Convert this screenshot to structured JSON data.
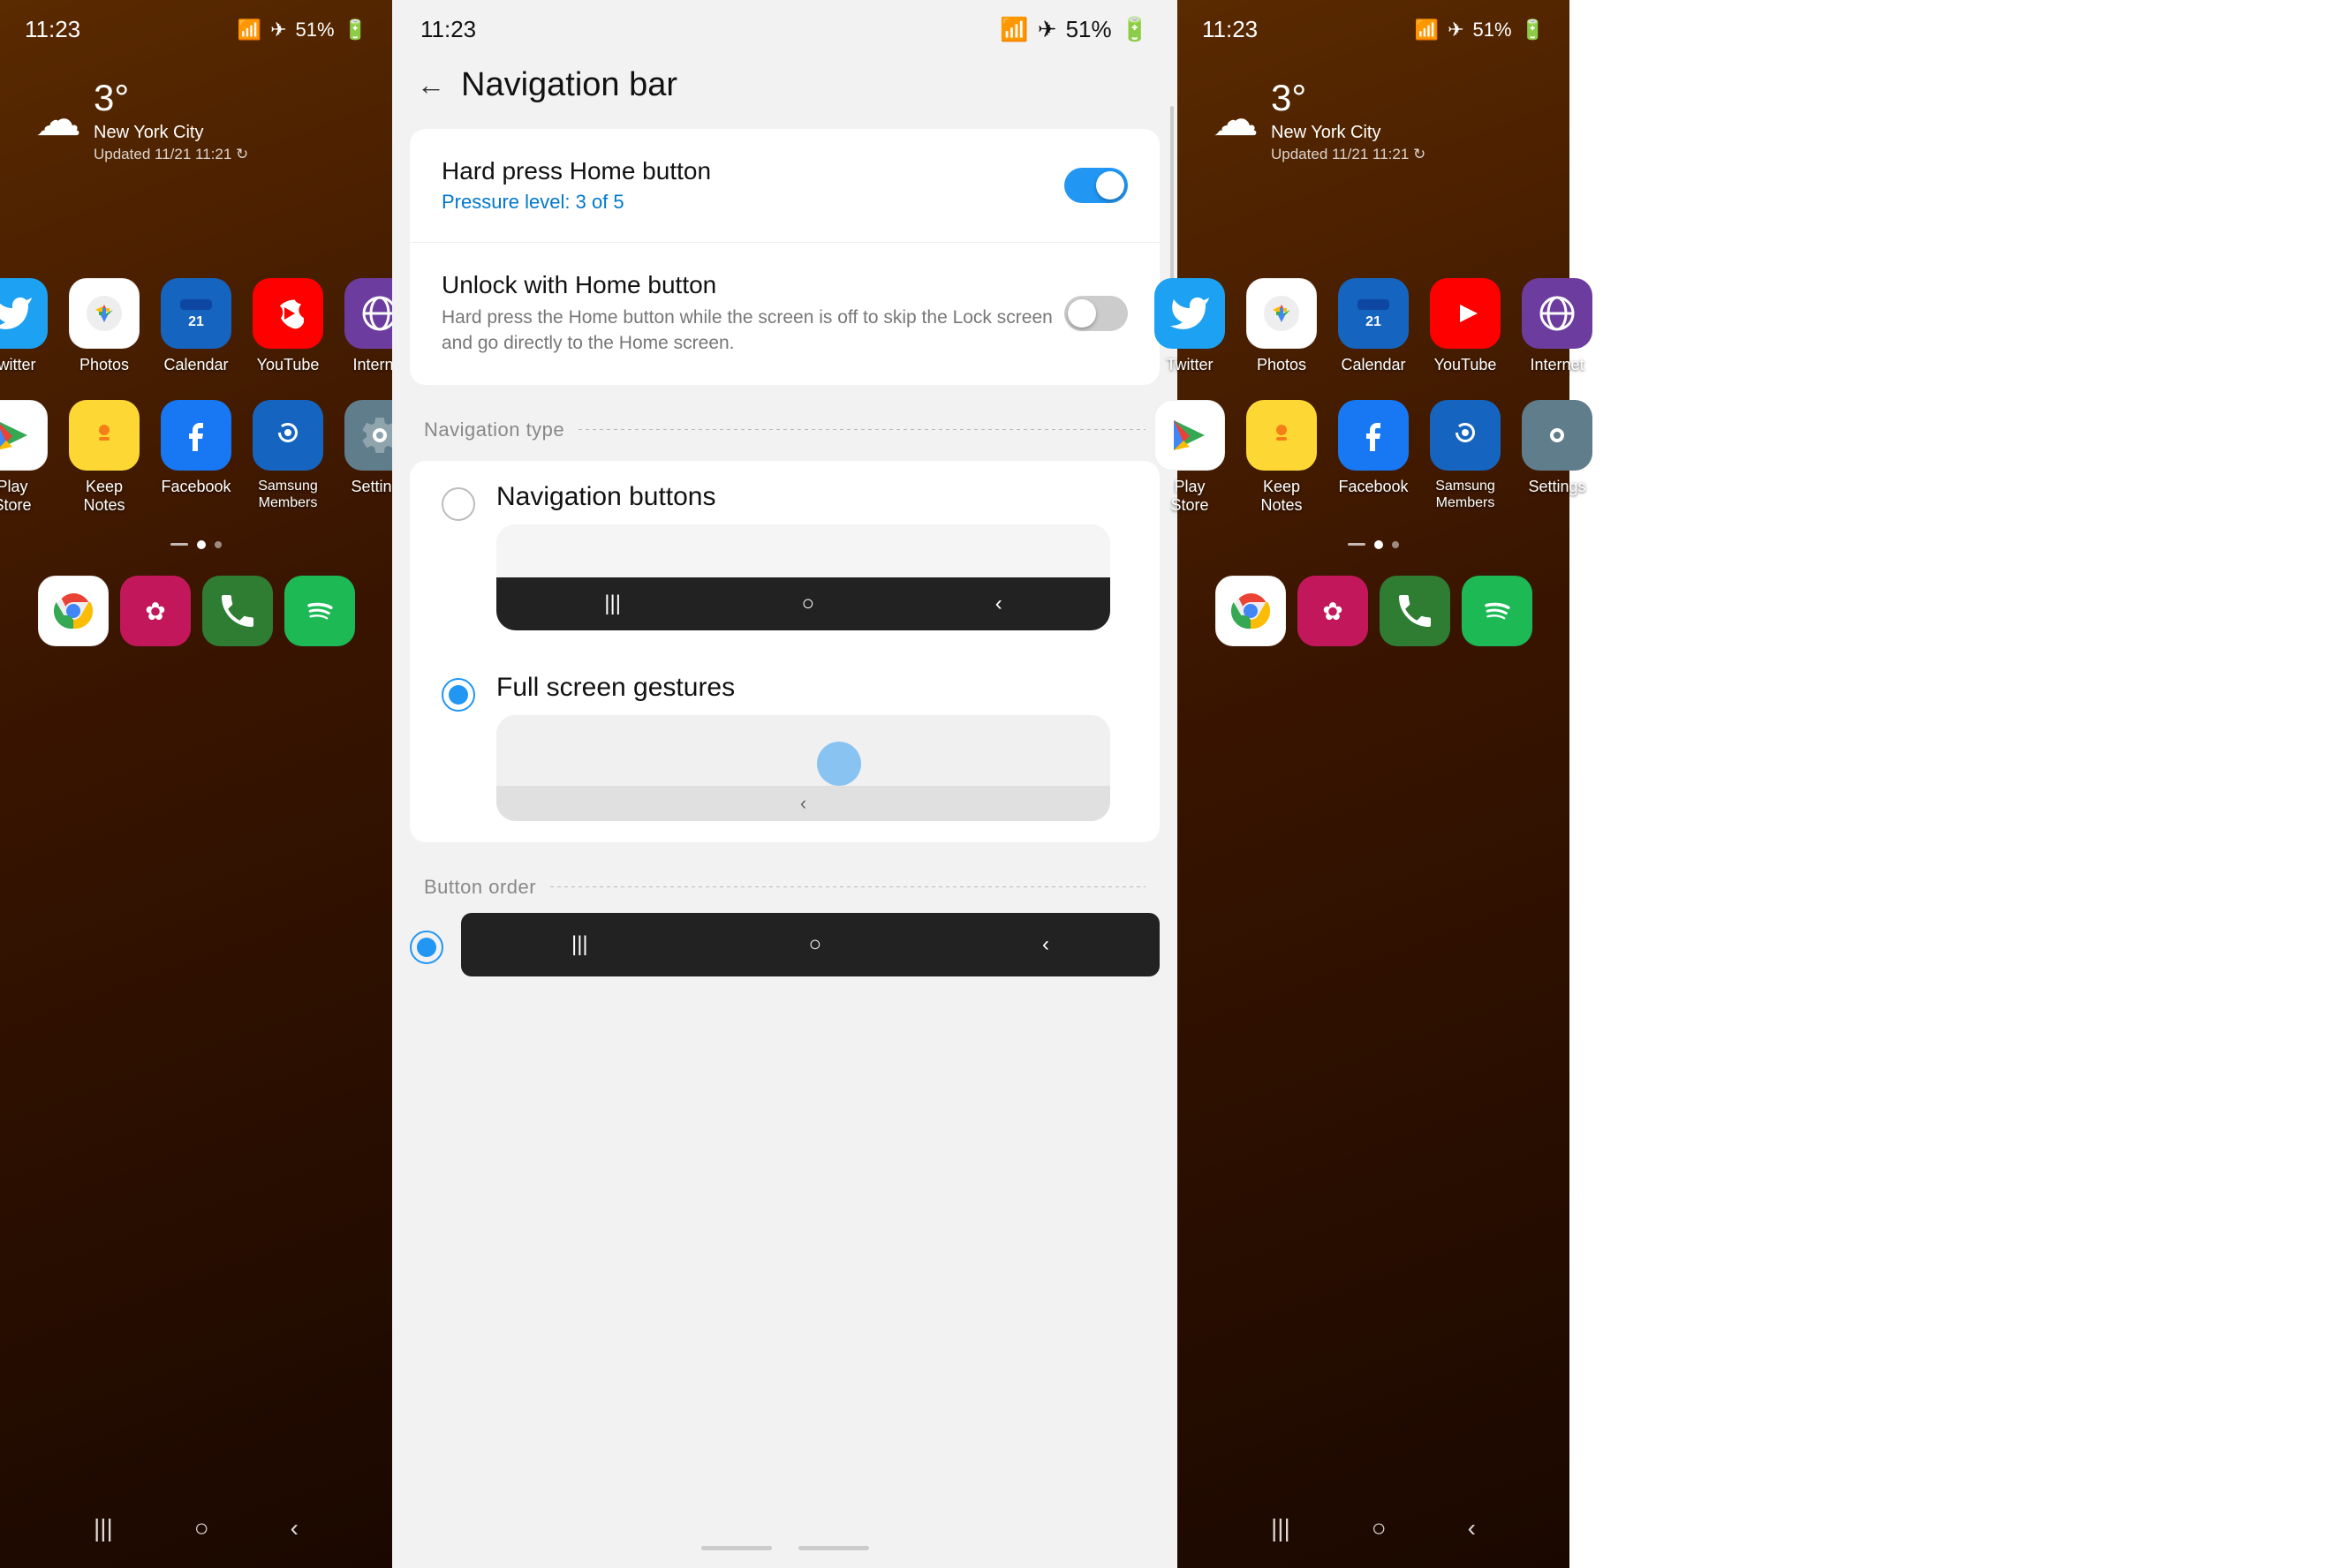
{
  "left_panel": {
    "status": {
      "time": "11:23",
      "battery": "51%"
    },
    "weather": {
      "temp": "3°",
      "city": "New York City",
      "updated": "Updated 11/21 11:21 ↻"
    },
    "apps_row1": [
      {
        "id": "twitter",
        "label": "Twitter",
        "icon_class": "icon-twitter",
        "emoji": "🐦"
      },
      {
        "id": "photos",
        "label": "Photos",
        "icon_class": "icon-photos",
        "emoji": "🎨"
      },
      {
        "id": "calendar",
        "label": "Calendar",
        "icon_class": "icon-calendar",
        "emoji": "📅"
      },
      {
        "id": "youtube",
        "label": "YouTube",
        "icon_class": "icon-youtube",
        "emoji": "▶"
      },
      {
        "id": "internet",
        "label": "Internet",
        "icon_class": "icon-internet",
        "emoji": "🌐"
      }
    ],
    "apps_row2": [
      {
        "id": "playstore",
        "label": "Play Store",
        "icon_class": "icon-playstore",
        "emoji": "▶"
      },
      {
        "id": "keepnotes",
        "label": "Keep Notes",
        "icon_class": "icon-keepnotes",
        "emoji": "💡"
      },
      {
        "id": "facebook",
        "label": "Facebook",
        "icon_class": "icon-facebook",
        "emoji": "f"
      },
      {
        "id": "samsung",
        "label": "Samsung Members",
        "icon_class": "icon-samsung",
        "emoji": "💎"
      },
      {
        "id": "settings",
        "label": "Settings",
        "icon_class": "icon-settings",
        "emoji": "⚙"
      }
    ],
    "dock_apps": [
      {
        "id": "chrome",
        "label": "",
        "icon_class": "icon-chrome",
        "emoji": "🌐"
      },
      {
        "id": "petal",
        "label": "",
        "icon_class": "icon-petal",
        "emoji": "✿"
      },
      {
        "id": "phone",
        "label": "",
        "icon_class": "icon-phone",
        "emoji": "📞"
      },
      {
        "id": "spotify",
        "label": "",
        "icon_class": "icon-spotify",
        "emoji": "♫"
      }
    ],
    "nav": {
      "recent": "|||",
      "home": "○",
      "back": "‹"
    }
  },
  "settings_panel": {
    "status": {
      "time": "11:23",
      "battery": "51%"
    },
    "title": "Navigation bar",
    "back_label": "←",
    "sections": {
      "hard_press": {
        "title": "Hard press Home button",
        "subtitle": "Pressure level: 3 of 5",
        "toggle_on": true
      },
      "unlock": {
        "title": "Unlock with Home button",
        "desc": "Hard press the Home button while the screen is off to skip the Lock screen and go directly to the Home screen.",
        "toggle_on": false
      }
    },
    "navigation_type_label": "Navigation type",
    "nav_options": [
      {
        "id": "nav_buttons",
        "label": "Navigation buttons",
        "selected": false,
        "bar_icons": [
          "|||",
          "○",
          "‹"
        ]
      },
      {
        "id": "full_gestures",
        "label": "Full screen gestures",
        "selected": true
      }
    ],
    "button_order_label": "Button order",
    "button_order_bar": [
      "|||",
      "○",
      "‹"
    ]
  },
  "right_panel": {
    "status": {
      "time": "11:23",
      "battery": "51%"
    },
    "weather": {
      "temp": "3°",
      "city": "New York City",
      "updated": "Updated 11/21 11:21 ↻"
    }
  }
}
